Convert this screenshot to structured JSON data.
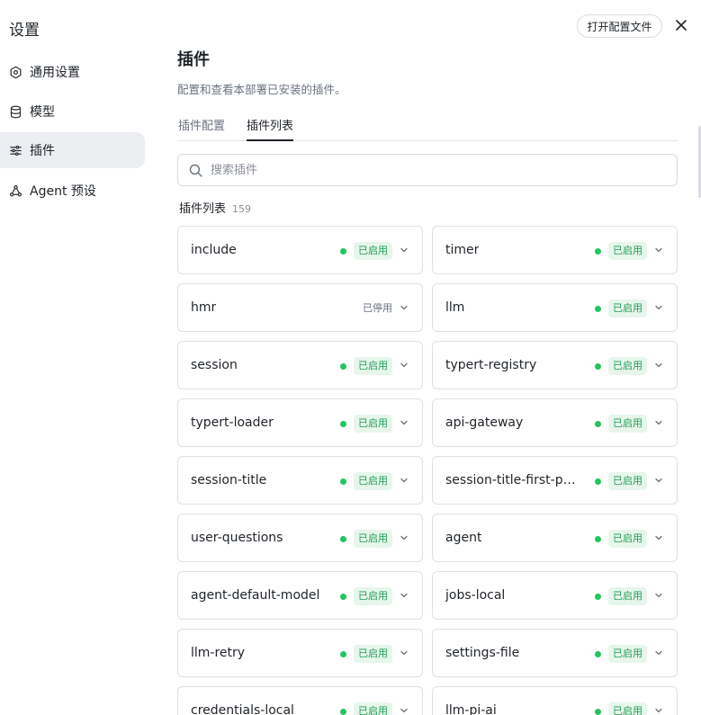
{
  "app": {
    "title": "设置"
  },
  "sidebar": {
    "items": [
      {
        "label": "通用设置",
        "icon": "gear-icon"
      },
      {
        "label": "模型",
        "icon": "database-icon"
      },
      {
        "label": "插件",
        "icon": "sliders-icon"
      },
      {
        "label": "Agent 预设",
        "icon": "agent-icon"
      }
    ]
  },
  "header": {
    "open_config_label": "打开配置文件"
  },
  "main": {
    "title": "插件",
    "description": "配置和查看本部署已安装的插件。",
    "tabs": [
      {
        "label": "插件配置"
      },
      {
        "label": "插件列表"
      }
    ],
    "search": {
      "placeholder": "搜索插件"
    },
    "list": {
      "title": "插件列表",
      "count": "159",
      "plugins": [
        {
          "name": "include",
          "status": "已启用",
          "enabled": true
        },
        {
          "name": "timer",
          "status": "已启用",
          "enabled": true
        },
        {
          "name": "hmr",
          "status": "已停用",
          "enabled": false
        },
        {
          "name": "llm",
          "status": "已启用",
          "enabled": true
        },
        {
          "name": "session",
          "status": "已启用",
          "enabled": true
        },
        {
          "name": "typert-registry",
          "status": "已启用",
          "enabled": true
        },
        {
          "name": "typert-loader",
          "status": "已启用",
          "enabled": true
        },
        {
          "name": "api-gateway",
          "status": "已启用",
          "enabled": true
        },
        {
          "name": "session-title",
          "status": "已启用",
          "enabled": true
        },
        {
          "name": "session-title-first-pr…",
          "status": "已启用",
          "enabled": true
        },
        {
          "name": "user-questions",
          "status": "已启用",
          "enabled": true
        },
        {
          "name": "agent",
          "status": "已启用",
          "enabled": true
        },
        {
          "name": "agent-default-model",
          "status": "已启用",
          "enabled": true
        },
        {
          "name": "jobs-local",
          "status": "已启用",
          "enabled": true
        },
        {
          "name": "llm-retry",
          "status": "已启用",
          "enabled": true
        },
        {
          "name": "settings-file",
          "status": "已启用",
          "enabled": true
        },
        {
          "name": "credentials-local",
          "status": "已启用",
          "enabled": true
        },
        {
          "name": "llm-pi-ai",
          "status": "已启用",
          "enabled": true
        }
      ]
    }
  },
  "colors": {
    "enabled_dot": "#22c55e",
    "enabled_badge_bg": "#e7f6ec",
    "enabled_badge_text": "#1f9d55",
    "active_nav_bg": "#eceef2"
  }
}
